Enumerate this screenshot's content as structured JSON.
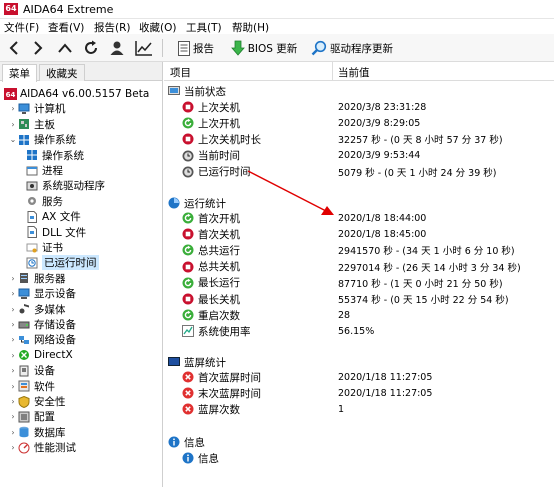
{
  "window": {
    "title": "AIDA64 Extreme",
    "logo_text": "64"
  },
  "menu": [
    {
      "label": "文件(F)"
    },
    {
      "label": "查看(V)"
    },
    {
      "label": "报告(R)"
    },
    {
      "label": "收藏(O)"
    },
    {
      "label": "工具(T)"
    },
    {
      "label": "帮助(H)"
    }
  ],
  "toolbar": {
    "report_label": "报告",
    "bios_label": "BIOS 更新",
    "driver_label": "驱动程序更新"
  },
  "tabs": {
    "menu": "菜单",
    "favorites": "收藏夹"
  },
  "tree": [
    {
      "label": "AIDA64 v6.00.5157 Beta",
      "icon": "aida64-logo-icon"
    },
    {
      "label": "计算机",
      "icon": "computer-icon"
    },
    {
      "label": "主板",
      "icon": "motherboard-icon"
    },
    {
      "label": "操作系统",
      "icon": "windows-icon"
    },
    {
      "label": "操作系统",
      "icon": "windows-icon"
    },
    {
      "label": "进程",
      "icon": "process-icon"
    },
    {
      "label": "系统驱动程序",
      "icon": "driver-icon"
    },
    {
      "label": "服务",
      "icon": "gear-icon"
    },
    {
      "label": "AX 文件",
      "icon": "file-icon"
    },
    {
      "label": "DLL 文件",
      "icon": "file-icon"
    },
    {
      "label": "证书",
      "icon": "certificate-icon"
    },
    {
      "label": "已运行时间",
      "icon": "uptime-icon"
    },
    {
      "label": "服务器",
      "icon": "server-icon"
    },
    {
      "label": "显示设备",
      "icon": "monitor-icon"
    },
    {
      "label": "多媒体",
      "icon": "multimedia-icon"
    },
    {
      "label": "存储设备",
      "icon": "storage-icon"
    },
    {
      "label": "网络设备",
      "icon": "network-icon"
    },
    {
      "label": "DirectX",
      "icon": "directx-icon"
    },
    {
      "label": "设备",
      "icon": "device-icon"
    },
    {
      "label": "软件",
      "icon": "software-icon"
    },
    {
      "label": "安全性",
      "icon": "security-icon"
    },
    {
      "label": "配置",
      "icon": "config-icon"
    },
    {
      "label": "数据库",
      "icon": "database-icon"
    },
    {
      "label": "性能测试",
      "icon": "benchmark-icon"
    }
  ],
  "columns": {
    "item": "项目",
    "value": "当前值"
  },
  "groups": {
    "current": "当前状态",
    "stats": "运行统计",
    "bsod": "蓝屏统计",
    "info": "信息"
  },
  "current_rows": [
    {
      "name": "上次关机",
      "value": "2020/3/8 23:31:28",
      "icon": "red-stop-icon"
    },
    {
      "name": "上次开机",
      "value": "2020/3/9 8:29:05",
      "icon": "green-start-icon"
    },
    {
      "name": "上次关机时长",
      "value": "32257 秒 - (0 天 8 小时 57 分 37 秒)",
      "icon": "red-stop-icon"
    },
    {
      "name": "当前时间",
      "value": "2020/3/9 9:53:44",
      "icon": "clock-icon"
    },
    {
      "name": "已运行时间",
      "value": "5079 秒 - (0 天 1 小时 24 分 39 秒)",
      "icon": "clock-icon"
    }
  ],
  "stats_rows": [
    {
      "name": "首次开机",
      "value": "2020/1/8 18:44:00",
      "icon": "green-start-icon"
    },
    {
      "name": "首次关机",
      "value": "2020/1/8 18:45:00",
      "icon": "red-stop-icon"
    },
    {
      "name": "总共运行",
      "value": "2941570 秒 - (34 天 1 小时 6 分 10 秒)",
      "icon": "green-start-icon"
    },
    {
      "name": "总共关机",
      "value": "2297014 秒 - (26 天 14 小时 3 分 34 秒)",
      "icon": "red-stop-icon"
    },
    {
      "name": "最长运行",
      "value": "87710 秒 - (1 天 0 小时 21 分 50 秒)",
      "icon": "green-start-icon"
    },
    {
      "name": "最长关机",
      "value": "55374 秒 - (0 天 15 小时 22 分 54 秒)",
      "icon": "red-stop-icon"
    },
    {
      "name": "重启次数",
      "value": "28",
      "icon": "green-refresh-icon"
    },
    {
      "name": "系统使用率",
      "value": "56.15%",
      "icon": "chart-icon"
    }
  ],
  "bsod_rows": [
    {
      "name": "首次蓝屏时间",
      "value": "2020/1/18 11:27:05",
      "icon": "red-x-icon"
    },
    {
      "name": "末次蓝屏时间",
      "value": "2020/1/18 11:27:05",
      "icon": "red-x-icon"
    },
    {
      "name": "蓝屏次数",
      "value": "1",
      "icon": "red-x-icon"
    }
  ],
  "info_rows": [
    {
      "name": "信息",
      "value": "",
      "icon": "info-icon"
    }
  ],
  "colors": {
    "accent_red": "#c8102e",
    "selection": "#cce8ff",
    "annotation_arrow": "#e00000",
    "info_blue": "#1e74c7"
  }
}
